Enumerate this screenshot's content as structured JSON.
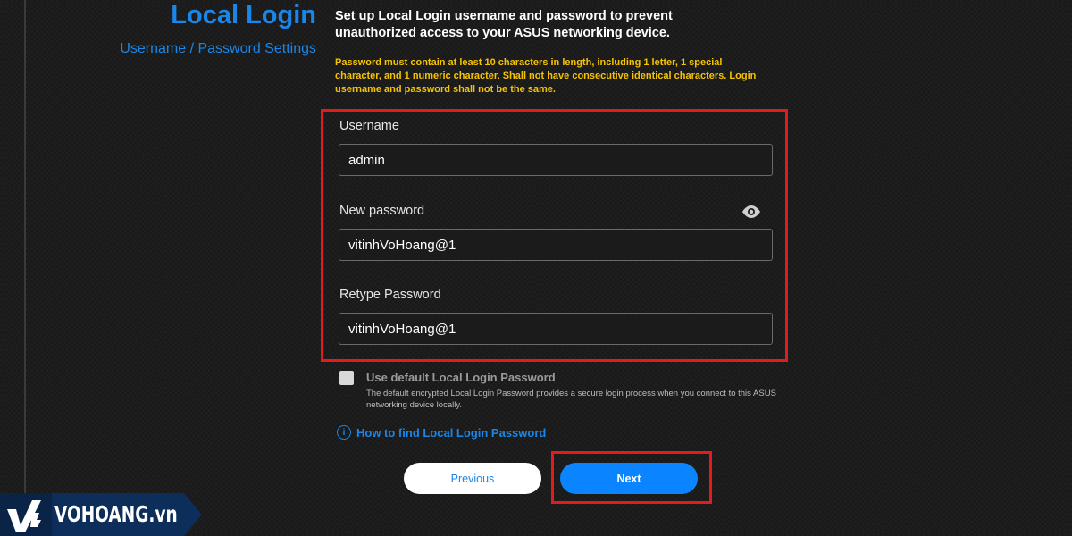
{
  "header": {
    "title": "Local Login",
    "subtitle": "Username / Password Settings"
  },
  "intro": "Set up Local Login username and password to prevent unauthorized access to your ASUS networking device.",
  "password_rules": "Password must contain at least 10 characters in length, including 1 letter, 1 special character, and 1 numeric character. Shall not have consecutive identical characters. Login username and password shall not be the same.",
  "form": {
    "username": {
      "label": "Username",
      "value": "admin"
    },
    "new_password": {
      "label": "New password",
      "value": "vitinhVoHoang@1",
      "reveal_icon": "eye-icon"
    },
    "retype_password": {
      "label": "Retype Password",
      "value": "vitinhVoHoang@1"
    }
  },
  "default_password": {
    "label": "Use default Local Login Password",
    "description": "The default encrypted Local Login Password provides a secure login process when you connect to this ASUS networking device locally.",
    "checked": false
  },
  "help_link": {
    "icon": "info-icon",
    "text": "How to find Local Login Password"
  },
  "buttons": {
    "previous": "Previous",
    "next": "Next"
  },
  "watermark": {
    "text": "VOHOANG.vn"
  },
  "colors": {
    "accent": "#1a86e8",
    "primary_button": "#0a84ff",
    "warning": "#f5c400",
    "highlight": "#e41b1b",
    "background": "#1c1c1c",
    "brand": "#0d2e5a"
  }
}
